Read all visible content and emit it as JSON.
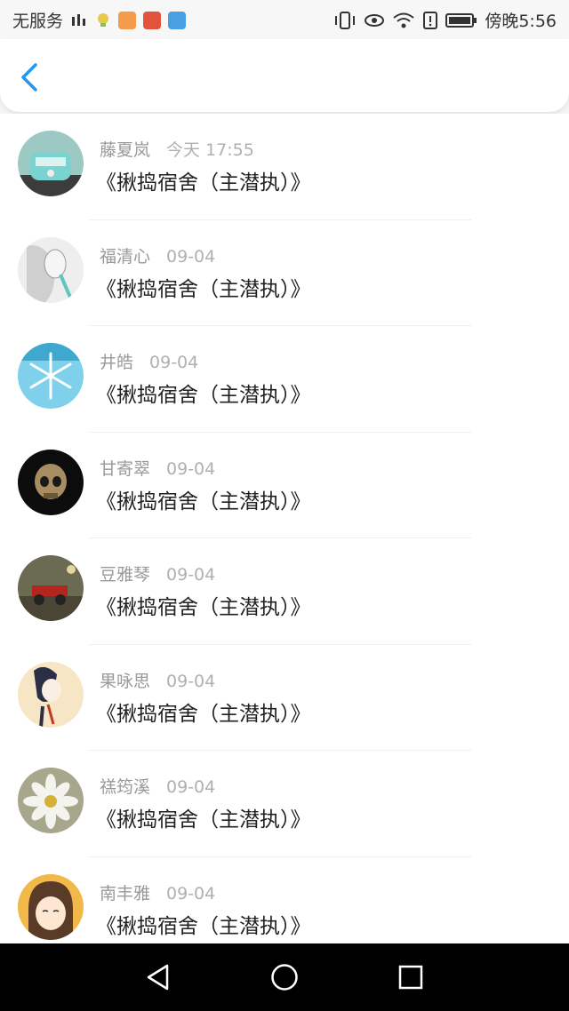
{
  "status_bar": {
    "carrier": "无服务",
    "signal_text": "Ⓜ",
    "time": "傍晚5:56"
  },
  "header": {
    "back_icon": "chevron-left-icon",
    "accent_color": "#2196F3"
  },
  "messages": [
    {
      "name": "藤夏岚",
      "date": "今天 17:55",
      "title": "《揪捣宿舍（主潜执）》",
      "avatar": "van"
    },
    {
      "name": "福清心",
      "date": "09-04",
      "title": "《揪捣宿舍（主潜执）》",
      "avatar": "sketch-girl"
    },
    {
      "name": "井皓",
      "date": "09-04",
      "title": "《揪捣宿舍（主潜执）》",
      "avatar": "snowflake"
    },
    {
      "name": "甘寄翠",
      "date": "09-04",
      "title": "《揪捣宿舍（主潜执）》",
      "avatar": "skull"
    },
    {
      "name": "豆雅琴",
      "date": "09-04",
      "title": "《揪捣宿舍（主潜执）》",
      "avatar": "toy-car"
    },
    {
      "name": "果咏思",
      "date": "09-04",
      "title": "《揪捣宿舍（主潜执）》",
      "avatar": "anime-girl"
    },
    {
      "name": "禚筠溪",
      "date": "09-04",
      "title": "《揪捣宿舍（主潜执）》",
      "avatar": "daisy"
    },
    {
      "name": "南丰雅",
      "date": "09-04",
      "title": "《揪捣宿舍（主潜执）》",
      "avatar": "cartoon-face"
    }
  ]
}
